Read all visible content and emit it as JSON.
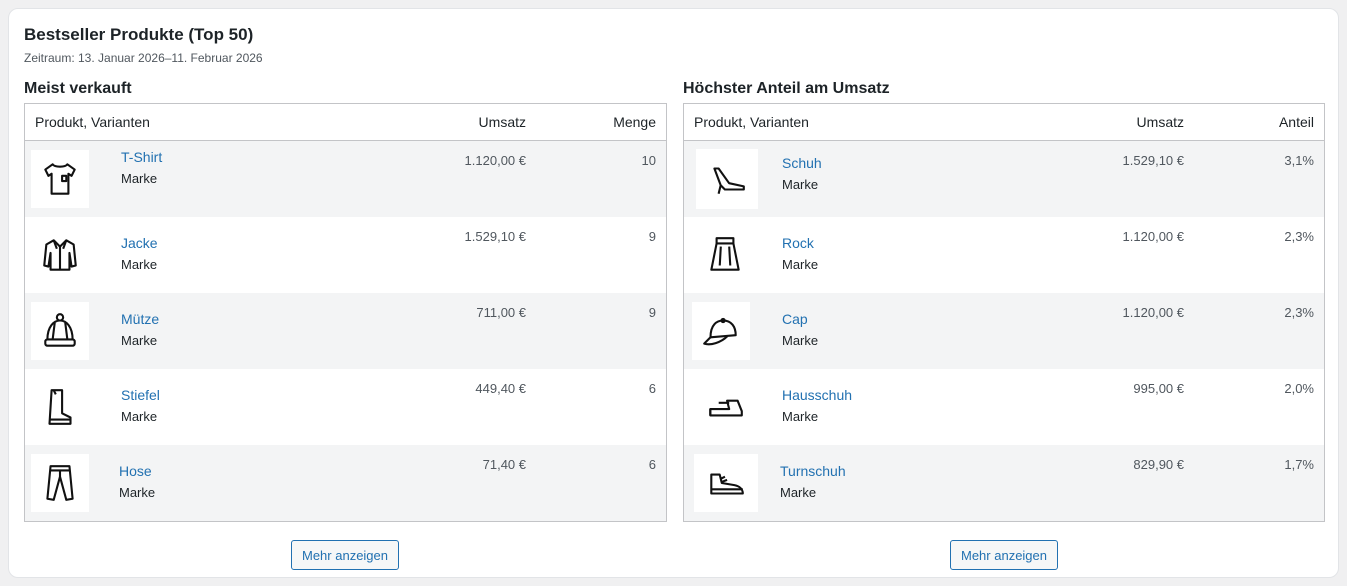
{
  "card": {
    "title": "Bestseller Produkte (Top 50)",
    "subtitle": "Zeitraum: 13. Januar 2026–11. Februar 2026"
  },
  "left": {
    "title": "Meist verkauft",
    "headers": {
      "product": "Produkt, Varianten",
      "col1": "Umsatz",
      "col2": "Menge"
    },
    "rows": [
      {
        "name": "T-Shirt",
        "brand": "Marke",
        "col1": "1.120,00 €",
        "col2": "10",
        "icon": "tshirt-icon"
      },
      {
        "name": "Jacke",
        "brand": "Marke",
        "col1": "1.529,10 €",
        "col2": "9",
        "icon": "jacket-icon"
      },
      {
        "name": "Mütze",
        "brand": "Marke",
        "col1": "711,00 €",
        "col2": "9",
        "icon": "beanie-icon"
      },
      {
        "name": "Stiefel",
        "brand": "Marke",
        "col1": "449,40 €",
        "col2": "6",
        "icon": "boot-icon"
      },
      {
        "name": "Hose",
        "brand": "Marke",
        "col1": "71,40 €",
        "col2": "6",
        "icon": "pants-icon"
      }
    ],
    "more_label": "Mehr anzeigen"
  },
  "right": {
    "title": "Höchster Anteil am Umsatz",
    "headers": {
      "product": "Produkt, Varianten",
      "col1": "Umsatz",
      "col2": "Anteil"
    },
    "rows": [
      {
        "name": "Schuh",
        "brand": "Marke",
        "col1": "1.529,10 €",
        "col2": "3,1%",
        "icon": "high-heel-icon"
      },
      {
        "name": "Rock",
        "brand": "Marke",
        "col1": "1.120,00 €",
        "col2": "2,3%",
        "icon": "skirt-icon"
      },
      {
        "name": "Cap",
        "brand": "Marke",
        "col1": "1.120,00 €",
        "col2": "2,3%",
        "icon": "cap-icon"
      },
      {
        "name": "Hausschuh",
        "brand": "Marke",
        "col1": "995,00 €",
        "col2": "2,0%",
        "icon": "slipper-icon"
      },
      {
        "name": "Turnschuh",
        "brand": "Marke",
        "col1": "829,90 €",
        "col2": "1,7%",
        "icon": "sneaker-icon"
      }
    ],
    "more_label": "Mehr anzeigen"
  }
}
